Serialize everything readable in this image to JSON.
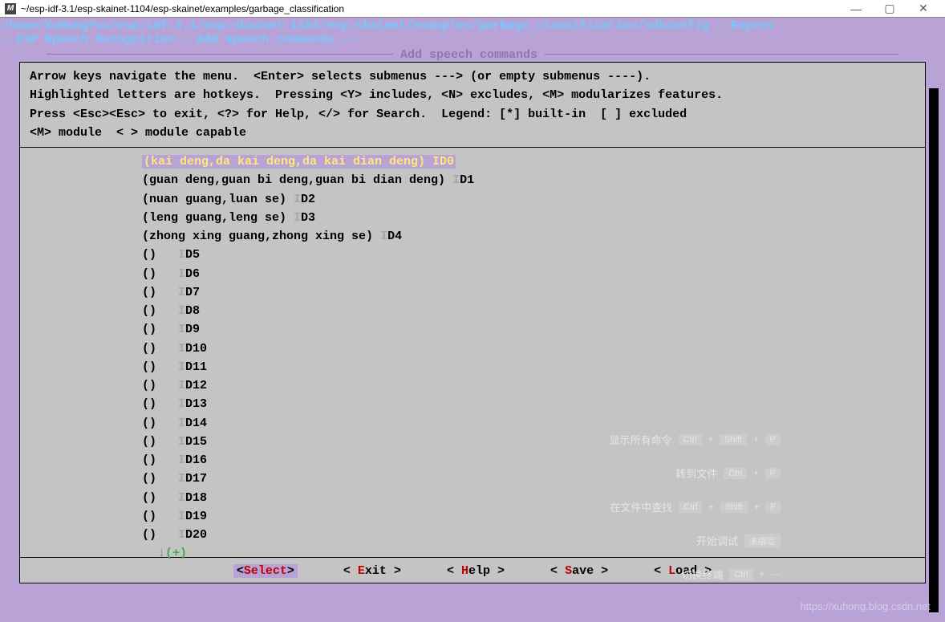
{
  "titlebar": {
    "icon_text": "M",
    "title": "~/esp-idf-3.1/esp-skainet-1104/esp-skainet/examples/garbage_classification",
    "min": "—",
    "max": "▢",
    "close": "✕"
  },
  "config_path": "/home/XuHongYss/esp-idf-3.1/esp-skainet-1104/esp-skainet/examples/garbage_classification/sdkconfig - Espres",
  "breadcrumb": "→ ESP Speech Recognition → Add speech commands ──",
  "menu_title": "──────────────────────────────────────────────── Add speech commands ─────────────────────────────────────────────────",
  "help_text": "Arrow keys navigate the menu.  <Enter> selects submenus ---> (or empty submenus ----).\nHighlighted letters are hotkeys.  Pressing <Y> includes, <N> excludes, <M> modularizes features.\nPress <Esc><Esc> to exit, <?> for Help, </> for Search.  Legend: [*] built-in  [ ] excluded\n<M> module  < > module capable",
  "entries": [
    {
      "highlighted": true,
      "text": "(kai deng,da kai deng,da kai dian deng) ID0"
    },
    {
      "highlighted": false,
      "text": "(guan deng,guan bi deng,guan bi dian deng) ",
      "suffix": "ID1"
    },
    {
      "highlighted": false,
      "text": "(nuan guang,luan se) ",
      "suffix": "ID2"
    },
    {
      "highlighted": false,
      "text": "(leng guang,leng se) ",
      "suffix": "ID3"
    },
    {
      "highlighted": false,
      "text": "(zhong xing guang,zhong xing se) ",
      "suffix": "ID4"
    },
    {
      "highlighted": false,
      "text": "()   ",
      "suffix": "ID5"
    },
    {
      "highlighted": false,
      "text": "()   ",
      "suffix": "ID6"
    },
    {
      "highlighted": false,
      "text": "()   ",
      "suffix": "ID7"
    },
    {
      "highlighted": false,
      "text": "()   ",
      "suffix": "ID8"
    },
    {
      "highlighted": false,
      "text": "()   ",
      "suffix": "ID9"
    },
    {
      "highlighted": false,
      "text": "()   ",
      "suffix": "ID10"
    },
    {
      "highlighted": false,
      "text": "()   ",
      "suffix": "ID11"
    },
    {
      "highlighted": false,
      "text": "()   ",
      "suffix": "ID12"
    },
    {
      "highlighted": false,
      "text": "()   ",
      "suffix": "ID13"
    },
    {
      "highlighted": false,
      "text": "()   ",
      "suffix": "ID14"
    },
    {
      "highlighted": false,
      "text": "()   ",
      "suffix": "ID15"
    },
    {
      "highlighted": false,
      "text": "()   ",
      "suffix": "ID16"
    },
    {
      "highlighted": false,
      "text": "()   ",
      "suffix": "ID17"
    },
    {
      "highlighted": false,
      "text": "()   ",
      "suffix": "ID18"
    },
    {
      "highlighted": false,
      "text": "()   ",
      "suffix": "ID19"
    },
    {
      "highlighted": false,
      "text": "()   ",
      "suffix": "ID20"
    }
  ],
  "more_indicator": "↓(+)",
  "buttons": {
    "select": {
      "ang_l": "<",
      "hot": "S",
      "rest": "elect",
      "ang_r": ">"
    },
    "exit": {
      "ang_l": "< ",
      "hot": "E",
      "rest": "xit ",
      "ang_r": ">"
    },
    "help": {
      "ang_l": "< ",
      "hot": "H",
      "rest": "elp ",
      "ang_r": ">"
    },
    "save": {
      "ang_l": "< ",
      "hot": "S",
      "rest": "ave ",
      "ang_r": ">"
    },
    "load": {
      "ang_l": "< ",
      "hot": "L",
      "rest": "oad ",
      "ang_r": ">"
    }
  },
  "overlay": {
    "rows": [
      {
        "label": "显示所有命令",
        "keys": [
          "Ctrl",
          "Shift",
          "P"
        ]
      },
      {
        "label": "转到文件",
        "keys": [
          "Ctrl",
          "P"
        ]
      },
      {
        "label": "在文件中查找",
        "keys": [
          "Ctrl",
          "Shift",
          "F"
        ]
      },
      {
        "label": "开始调试",
        "keys": [
          "未绑定"
        ]
      },
      {
        "label": "切换终端",
        "keys": [
          "Ctrl",
          " "
        ]
      }
    ]
  },
  "watermark": "https://xuhong.blog.csdn.net"
}
